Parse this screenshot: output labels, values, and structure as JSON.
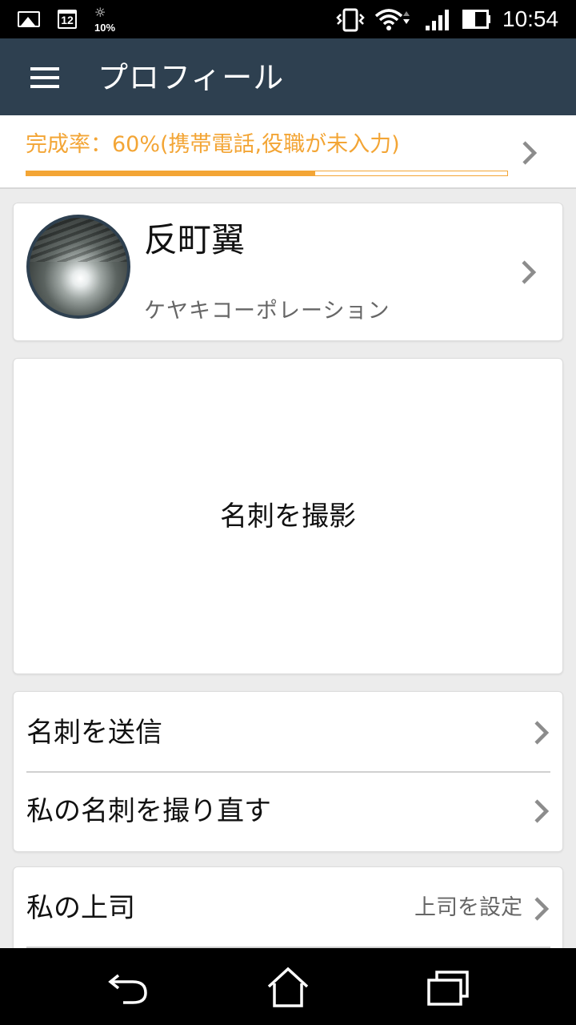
{
  "status_bar": {
    "calendar_day": "12",
    "weather_icon": "weather-sun-cloud-icon",
    "weather_percent": "10%",
    "time": "10:54",
    "icons": [
      "gallery-icon",
      "calendar-icon",
      "weather-icon",
      "vibrate-icon",
      "wifi-icon",
      "signal-icon",
      "battery-icon"
    ]
  },
  "app_bar": {
    "title": "プロフィール",
    "menu_icon": "hamburger-menu-icon"
  },
  "completion": {
    "text": "完成率：60%(携帯電話,役職が未入力)",
    "progress": 0.6,
    "accent_color": "#f3a535"
  },
  "profile": {
    "name": "反町翼",
    "company": "ケヤキコーポレーション"
  },
  "business_card": {
    "label": "名刺を撮影"
  },
  "actions": [
    {
      "label": "名刺を送信"
    },
    {
      "label": "私の名刺を撮り直す"
    }
  ],
  "boss": {
    "label": "私の上司",
    "value": "上司を設定"
  },
  "colors": {
    "app_bar": "#2e4050",
    "background": "#ececec",
    "accent": "#f3a535"
  },
  "nav_bar": {
    "icons": [
      "back-icon",
      "home-icon",
      "recent-apps-icon"
    ]
  }
}
